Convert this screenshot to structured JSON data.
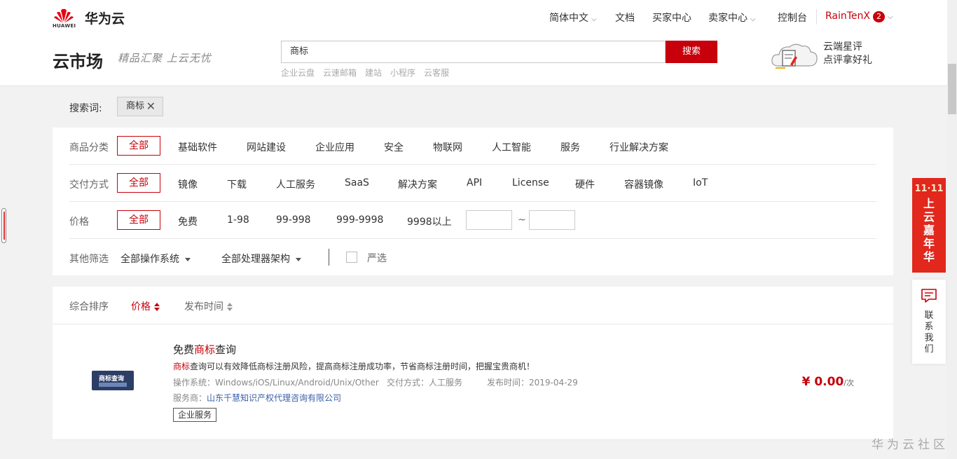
{
  "header": {
    "logo_text": "HUAWEI",
    "brand": "华为云",
    "nav": {
      "language": "简体中文",
      "docs": "文档",
      "buyer_center": "买家中心",
      "seller_center": "卖家中心",
      "console": "控制台",
      "username": "RainTenX",
      "notification_count": "2"
    },
    "market_title": "云市场",
    "slogan": "精品汇聚 上云无忧",
    "search": {
      "value": "商标",
      "button_label": "搜索",
      "hot_words": [
        "企业云盘",
        "云速邮箱",
        "建站",
        "小程序",
        "云客服"
      ]
    },
    "promo": {
      "line1": "云端星评",
      "line2": "点评拿好礼"
    }
  },
  "search_term": {
    "label": "搜索词:",
    "chip": "商标"
  },
  "filters": {
    "category": {
      "label": "商品分类",
      "options": [
        "全部",
        "基础软件",
        "网站建设",
        "企业应用",
        "安全",
        "物联网",
        "人工智能",
        "服务",
        "行业解决方案"
      ]
    },
    "delivery": {
      "label": "交付方式",
      "options": [
        "全部",
        "镜像",
        "下载",
        "人工服务",
        "SaaS",
        "解决方案",
        "API",
        "License",
        "硬件",
        "容器镜像",
        "IoT"
      ]
    },
    "price": {
      "label": "价格",
      "options": [
        "全部",
        "免费",
        "1-98",
        "99-998",
        "999-9998",
        "9998以上"
      ],
      "range_separator": "~"
    },
    "other": {
      "label": "其他筛选",
      "os_dropdown": "全部操作系统",
      "arch_dropdown": "全部处理器架构",
      "strict_label": "严选"
    }
  },
  "sort": {
    "label": "综合排序",
    "price": "价格",
    "publish_time": "发布时间"
  },
  "products": [
    {
      "thumb_text": "商标查询",
      "title_prefix": "免费",
      "title_highlight": "商标",
      "title_suffix": "查询",
      "desc_highlight": "商标",
      "desc_rest": "查询可以有效降低商标注册风险，提高商标注册成功率，节省商标注册时间，把握宝贵商机！",
      "os": "操作系统：Windows/iOS/Linux/Android/Unix/Other",
      "delivery": "交付方式：人工服务",
      "published": "发布时间：2019-04-29",
      "vendor_label": "服务商：",
      "vendor": "山东千慧知识产权代理咨询有限公司",
      "tag": "企业服务",
      "price": "¥ 0.00",
      "unit": "/次"
    }
  ],
  "side": {
    "banner_top": "11·11",
    "banner_text": "上云嘉年华",
    "contact": "联系我们"
  },
  "watermark": "华为云社区",
  "colors": {
    "brand_red": "#c7000b",
    "banner_red": "#e2271d"
  }
}
